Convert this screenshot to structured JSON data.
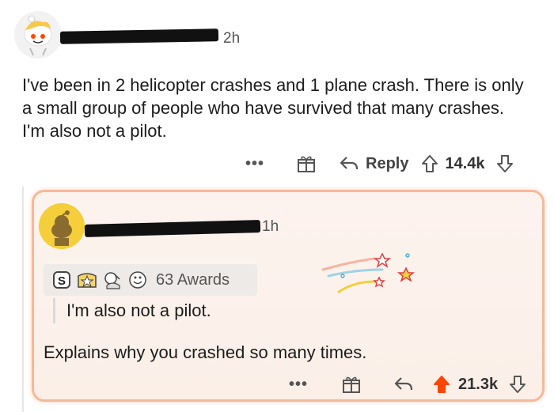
{
  "top_comment": {
    "time": "2h",
    "body": "I've been in 2 helicopter crashes and 1 plane crash. There is only a small group of people who have survived that many crashes. I'm also not a pilot.",
    "more": "•••",
    "reply_label": "Reply",
    "votes": "14.4k"
  },
  "reply_comment": {
    "time": "1h",
    "awards_count": "63 Awards",
    "quote": "I'm also not a pilot.",
    "body": "Explains why you crashed so many times.",
    "more": "•••",
    "votes": "21.3k"
  },
  "colors": {
    "upvote_active": "#ff4500",
    "card_border": "#f6b99a",
    "card_bg": "#fdf3ee",
    "avatar_reply_bg": "#f4cf3b"
  },
  "icons": [
    "snoo-avatar-icon",
    "gift-icon",
    "reply-arrow-icon",
    "upvote-icon",
    "downvote-icon",
    "award-icon",
    "sparkle-icon"
  ]
}
